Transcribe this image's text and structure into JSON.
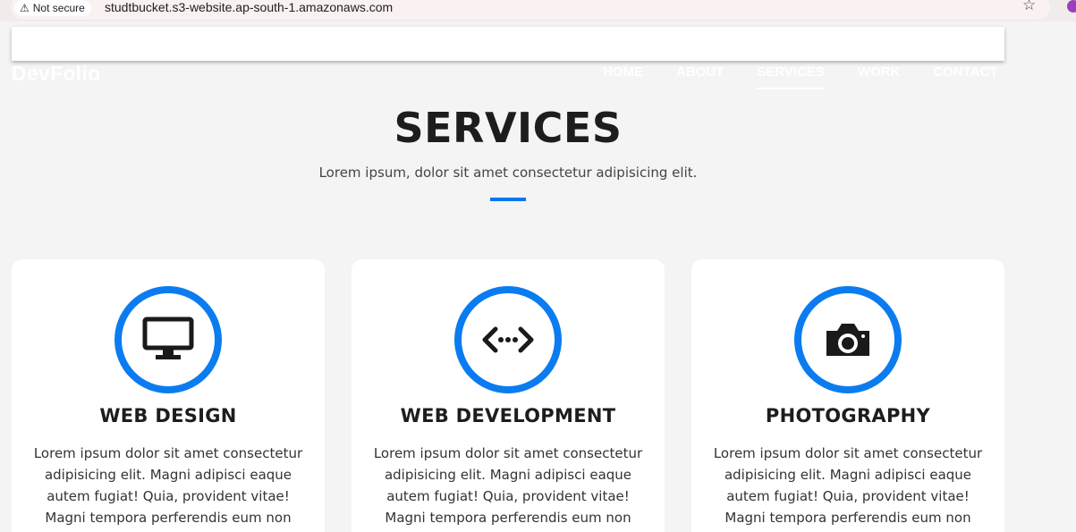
{
  "browser": {
    "security_label": "Not secure",
    "url": "studtbucket.s3-website.ap-south-1.amazonaws.com"
  },
  "site": {
    "brand": "DevFolio",
    "nav": [
      "HOME",
      "ABOUT",
      "SERVICES",
      "WORK",
      "CONTACT"
    ],
    "active_nav": "SERVICES"
  },
  "section": {
    "title": "SERVICES",
    "subtitle": "Lorem ipsum, dolor sit amet consectetur adipisicing elit.",
    "accent_color": "#0078f2"
  },
  "cards": [
    {
      "icon": "desktop-icon",
      "title": "WEB DESIGN",
      "text": "Lorem ipsum dolor sit amet consectetur adipisicing elit. Magni adipisci eaque autem fugiat! Quia, provident vitae! Magni tempora perferendis eum non provident."
    },
    {
      "icon": "code-icon",
      "title": "WEB DEVELOPMENT",
      "text": "Lorem ipsum dolor sit amet consectetur adipisicing elit. Magni adipisci eaque autem fugiat! Quia, provident vitae! Magni tempora perferendis eum non provident."
    },
    {
      "icon": "camera-icon",
      "title": "PHOTOGRAPHY",
      "text": "Lorem ipsum dolor sit amet consectetur adipisicing elit. Magni adipisci eaque autem fugiat! Quia, provident vitae! Magni tempora perferendis eum non provident."
    }
  ]
}
